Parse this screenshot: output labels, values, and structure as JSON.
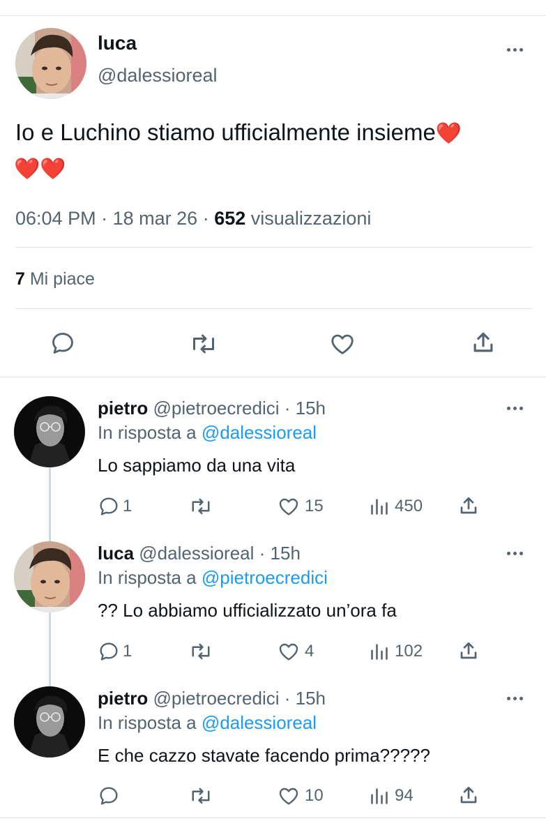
{
  "main_tweet": {
    "author_name": "luca",
    "author_handle": "@dalessioreal",
    "text": "Io e Luchino stiamo ufficialmente insieme",
    "emoji": [
      "❤️",
      "❤️",
      "❤️"
    ],
    "time": "06:04 PM",
    "date": "18 mar 26",
    "separator": "·",
    "views_count": "652",
    "views_label": "visualizzazioni",
    "likes_count": "7",
    "likes_label": "Mi piace"
  },
  "replies": [
    {
      "author_name": "pietro",
      "author_handle": "@pietroecredici",
      "time_ago": "· 15h",
      "reply_prefix": "In risposta a",
      "reply_to": "@dalessioreal",
      "text": "Lo sappiamo da una vita",
      "reply_count": "1",
      "like_count": "15",
      "view_count": "450"
    },
    {
      "author_name": "luca",
      "author_handle": "@dalessioreal",
      "time_ago": "· 15h",
      "reply_prefix": "In risposta a",
      "reply_to": "@pietroecredici",
      "text": "?? Lo abbiamo ufficializzato un’ora fa",
      "reply_count": "1",
      "like_count": "4",
      "view_count": "102"
    },
    {
      "author_name": "pietro",
      "author_handle": "@pietroecredici",
      "time_ago": "· 15h",
      "reply_prefix": "In risposta a",
      "reply_to": "@dalessioreal",
      "text": "E che cazzo stavate facendo prima?????",
      "reply_count": "",
      "like_count": "10",
      "view_count": "94"
    }
  ],
  "icons": [
    "comment-icon",
    "retweet-icon",
    "heart-icon",
    "share-icon",
    "views-icon",
    "more-icon"
  ],
  "colors": {
    "text": "#0f1419",
    "secondary": "#536471",
    "link": "#1d9bf0",
    "heart": "#e0245e",
    "divider": "#e1e6ea"
  }
}
